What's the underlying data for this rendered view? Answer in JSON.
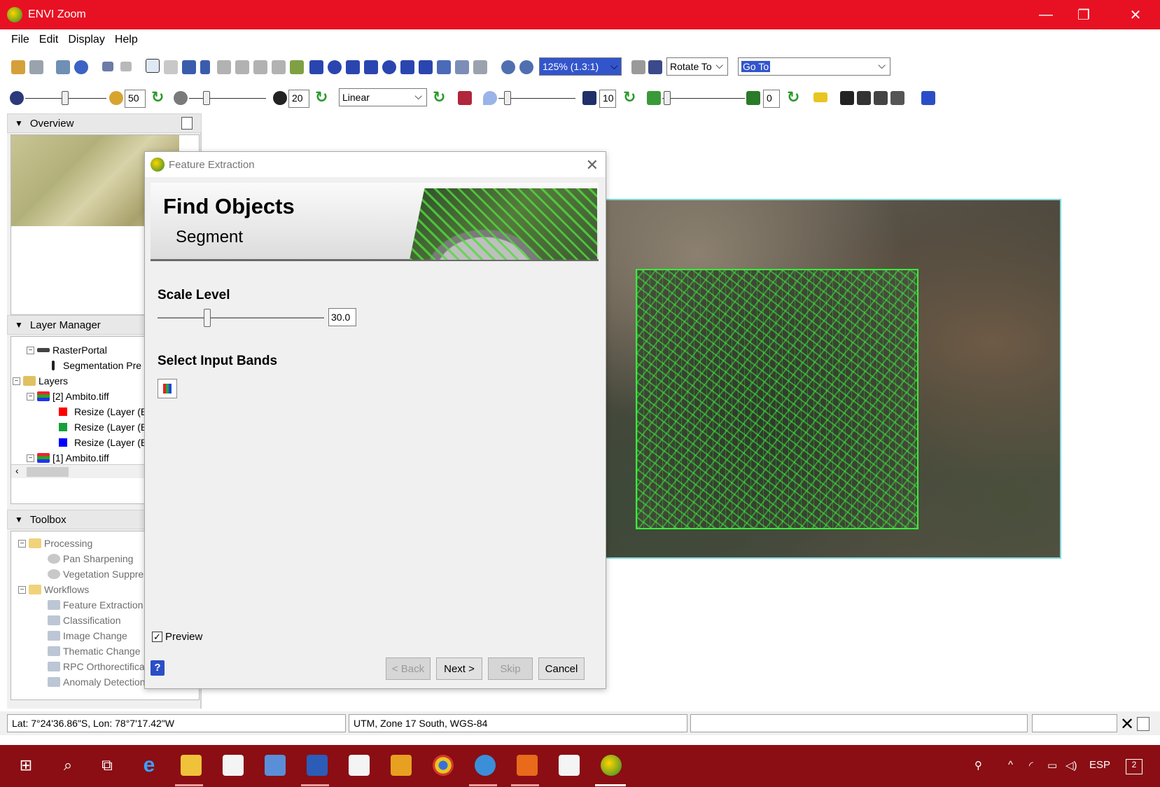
{
  "window": {
    "title": "ENVI Zoom",
    "controls": [
      "—",
      "❐",
      "✕"
    ]
  },
  "menu": [
    "File",
    "Edit",
    "Display",
    "Help"
  ],
  "toolbar1": {
    "zoom_value": "125% (1.3:1)",
    "rotate_label": "Rotate To",
    "goto_value": "Go To"
  },
  "toolbar2": {
    "brightness": "50",
    "contrast": "20",
    "stretch": "Linear",
    "sharpen": "10",
    "transparency": "0"
  },
  "panels": {
    "overview": "Overview",
    "layer_manager": "Layer Manager",
    "toolbox": "Toolbox"
  },
  "layers": [
    {
      "label": "RasterPortal"
    },
    {
      "label": "Segmentation Pre"
    },
    {
      "label": "Layers"
    },
    {
      "label": "[2] Ambito.tiff"
    },
    {
      "label": "Resize (Layer (Ba",
      "color": "#ff0000"
    },
    {
      "label": "Resize (Layer (Ba",
      "color": "#16a03a"
    },
    {
      "label": "Resize (Layer (Ba",
      "color": "#0000ff"
    },
    {
      "label": "[1] Ambito.tiff"
    }
  ],
  "toolbox": [
    {
      "label": "Processing"
    },
    {
      "label": "Pan Sharpening"
    },
    {
      "label": "Vegetation Suppres"
    },
    {
      "label": "Workflows"
    },
    {
      "label": "Feature Extraction"
    },
    {
      "label": "Classification"
    },
    {
      "label": "Image Change"
    },
    {
      "label": "Thematic Change"
    },
    {
      "label": "RPC Orthorectificat"
    },
    {
      "label": "Anomaly Detection"
    }
  ],
  "dialog": {
    "title": "Feature Extraction",
    "banner_title": "Find Objects",
    "banner_subtitle": "Segment",
    "scale_label": "Scale Level",
    "scale_value": "30.0",
    "scale_fraction": 0.3,
    "bands_label": "Select Input Bands",
    "preview_label": "Preview",
    "preview_checked": true,
    "buttons": {
      "back": "< Back",
      "next": "Next >",
      "skip": "Skip",
      "cancel": "Cancel"
    }
  },
  "status": {
    "coords": "Lat: 7°24'36.86\"S, Lon: 78°7'17.42\"W",
    "projection": "UTM, Zone 17 South, WGS-84"
  },
  "taskbar": {
    "language": "ESP",
    "notification_count": "2"
  },
  "colors": {
    "title_bar": "#e81123",
    "taskbar": "#8a0e14",
    "segment_outline": "#3bea3b",
    "extent_outline": "#7fd6d6"
  }
}
